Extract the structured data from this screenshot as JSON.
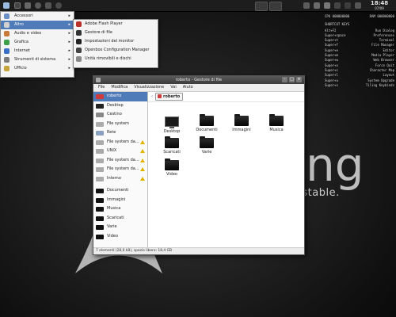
{
  "panel": {
    "clock_time": "18:48",
    "clock_date": "07/09"
  },
  "conky": {
    "cpu_label": "CPU",
    "cpu_value": "000000000",
    "ram_label": "RAM",
    "ram_value": "000000000",
    "shortcut_title": "SHORTCUT KEYS",
    "shortcuts": [
      {
        "key": "Alt+F2",
        "action": "Run Dialog"
      },
      {
        "key": "Super+space",
        "action": "Preferences"
      },
      {
        "key": "Super+t",
        "action": "Terminal"
      },
      {
        "key": "Super+f",
        "action": "File Manager"
      },
      {
        "key": "Super+e",
        "action": "Editor"
      },
      {
        "key": "Super+m",
        "action": "Media Player"
      },
      {
        "key": "Super+w",
        "action": "Web Browser"
      },
      {
        "key": "Super+x",
        "action": "Force Quit"
      },
      {
        "key": "Super+c",
        "action": "Character Map"
      },
      {
        "key": "Super+l",
        "action": "Layout"
      },
      {
        "key": "Super+u",
        "action": "System Upgrade"
      },
      {
        "key": "Super+s",
        "action": "Tiling Keybinds"
      }
    ]
  },
  "wallpaper": {
    "logo_text": "ng",
    "tagline": "d stable."
  },
  "menu": {
    "items": [
      {
        "label": "Accessori",
        "color": "#6a8fc7"
      },
      {
        "label": "Altro",
        "color": "#d0d0d0",
        "active": true
      },
      {
        "label": "Audio e video",
        "color": "#c77a3a"
      },
      {
        "label": "Grafica",
        "color": "#3ca04a"
      },
      {
        "label": "Internet",
        "color": "#3a6fc7"
      },
      {
        "label": "Strumenti di sistema",
        "color": "#7c7c7c"
      },
      {
        "label": "Ufficio",
        "color": "#c7a43a"
      }
    ],
    "submenu": [
      {
        "label": "Adobe Flash Player",
        "color": "#b8322a"
      },
      {
        "label": "Gestore di file",
        "color": "#333333"
      },
      {
        "label": "Impostazioni del monitor",
        "color": "#222222"
      },
      {
        "label": "Openbox Configuration Manager",
        "color": "#444444"
      },
      {
        "label": "Unità rimovibili e dischi",
        "color": "#888888"
      }
    ]
  },
  "file_manager": {
    "title": "roberto - Gestore di file",
    "menubar": [
      "File",
      "Modifica",
      "Visualizzazione",
      "Vai",
      "Aiuto"
    ],
    "sidebar": [
      {
        "label": "roberto",
        "selected": true,
        "color": "#cf3a3a"
      },
      {
        "label": "Desktop",
        "color": "#222222"
      },
      {
        "label": "Cestino",
        "color": "#888888"
      },
      {
        "label": "File system",
        "color": "#aaaaaa"
      },
      {
        "label": "Rete",
        "color": "#8aa0c0"
      },
      {
        "label": "File system da...",
        "color": "#aaaaaa",
        "eject": true
      },
      {
        "label": "UNIX",
        "color": "#aaaaaa",
        "eject": true
      },
      {
        "label": "File system da...",
        "color": "#aaaaaa",
        "eject": true
      },
      {
        "label": "File system da...",
        "color": "#aaaaaa",
        "eject": true
      },
      {
        "label": "Interno",
        "color": "#aaaaaa",
        "eject": true
      },
      {
        "label": "Documenti",
        "color": "#111111",
        "gap": true
      },
      {
        "label": "Immagini",
        "color": "#111111"
      },
      {
        "label": "Musica",
        "color": "#111111"
      },
      {
        "label": "Scaricati",
        "color": "#111111"
      },
      {
        "label": "Varie",
        "color": "#111111"
      },
      {
        "label": "Video",
        "color": "#111111"
      }
    ],
    "path": "roberto",
    "items": [
      {
        "label": "Desktop",
        "kind": "monitor"
      },
      {
        "label": "Documenti",
        "kind": "folder"
      },
      {
        "label": "Immagini",
        "kind": "folder"
      },
      {
        "label": "Musica",
        "kind": "folder"
      },
      {
        "label": "Scaricati",
        "kind": "folder"
      },
      {
        "label": "Varie",
        "kind": "folder"
      },
      {
        "label": "Video",
        "kind": "folder"
      }
    ],
    "status": "7 elementi (28,0 kB), spazio libero: 18,4 GB"
  }
}
